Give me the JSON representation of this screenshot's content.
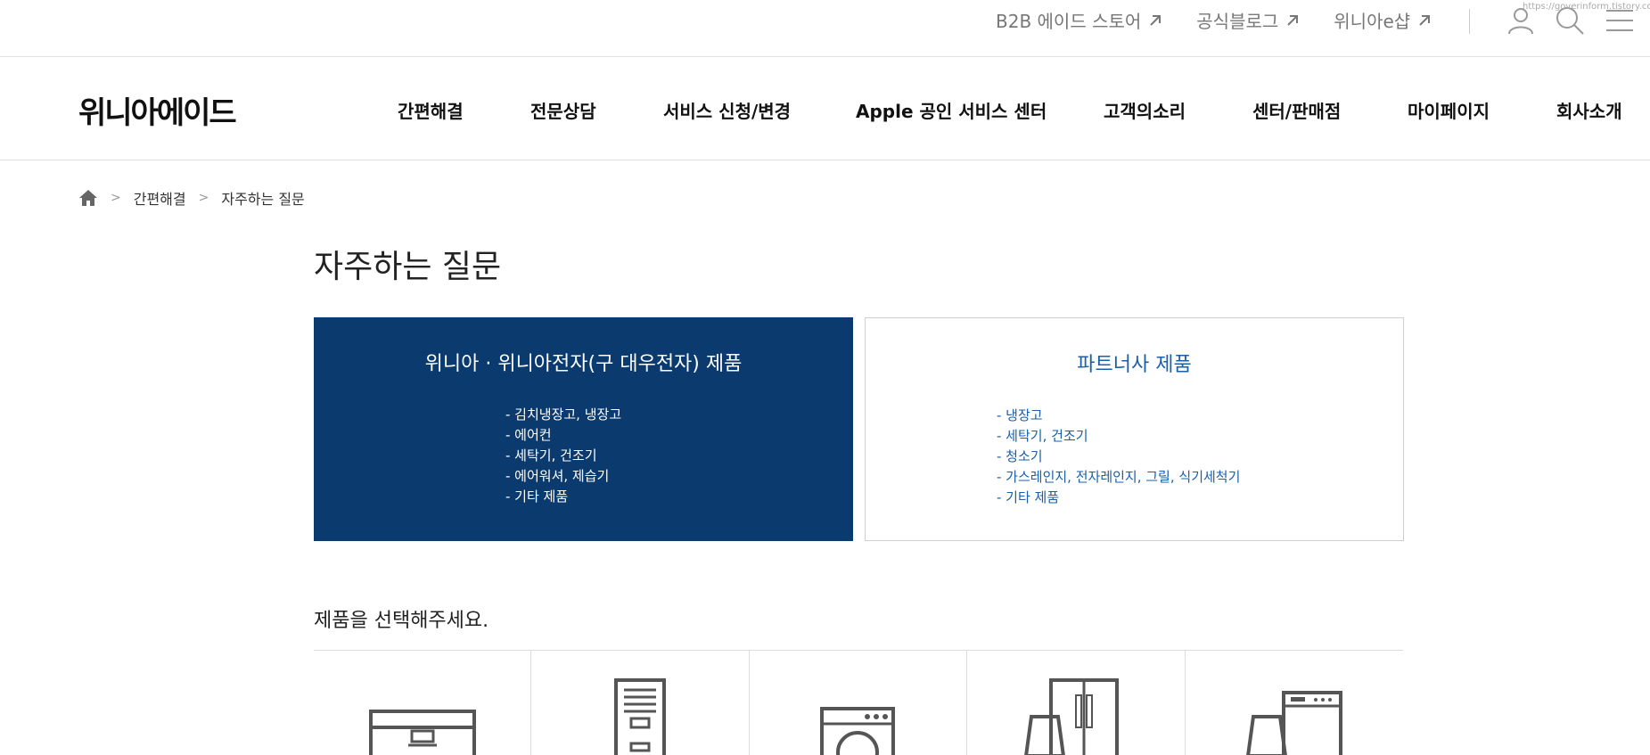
{
  "util": {
    "links": [
      {
        "label": "B2B 에이드 스토어"
      },
      {
        "label": "공식블로그"
      },
      {
        "label": "위니아e샵"
      }
    ],
    "url_text": "https://goverinform.tistory.com",
    "icons": [
      "user-icon",
      "search-icon",
      "menu-icon"
    ]
  },
  "header": {
    "logo": "위니아에이드",
    "nav": [
      {
        "label": "간편해결"
      },
      {
        "label": "전문상담"
      },
      {
        "label": "서비스 신청/변경"
      },
      {
        "label": "Apple 공인 서비스 센터"
      },
      {
        "label": "고객의소리"
      },
      {
        "label": "센터/판매점"
      },
      {
        "label": "마이페이지"
      },
      {
        "label": "회사소개"
      }
    ]
  },
  "breadcrumb": {
    "items": [
      {
        "label": "간편해결"
      },
      {
        "label": "자주하는 질문"
      }
    ]
  },
  "page": {
    "title": "자주하는 질문"
  },
  "categories": [
    {
      "title": "위니아 · 위니아전자(구 대우전자) 제품",
      "items": [
        "- 김치냉장고, 냉장고",
        "- 에어컨",
        "- 세탁기, 건조기",
        "- 에어워셔, 제습기",
        "- 기타 제품"
      ],
      "active": true
    },
    {
      "title": "파트너사 제품",
      "items": [
        "- 냉장고",
        "- 세탁기, 건조기",
        "- 청소기",
        "- 가스레인지, 전자레인지, 그릴, 식기세척기",
        "- 기타 제품"
      ],
      "active": false
    }
  ],
  "products": {
    "heading": "제품을 선택해주세요.",
    "icons": [
      "kimchi-refrigerator-icon",
      "air-conditioner-icon",
      "washing-machine-icon",
      "refrigerator-icon",
      "dishwasher-icon"
    ]
  },
  "colors": {
    "active_box": "#0b3a6e",
    "partner_text": "#1a5fa8"
  }
}
